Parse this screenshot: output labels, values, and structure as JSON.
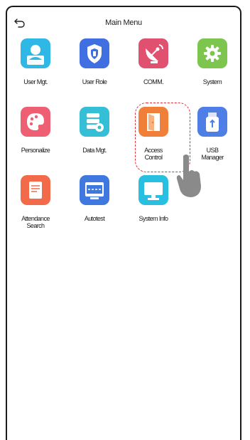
{
  "header": {
    "back_icon": "back-arrow-icon",
    "title": "Main Menu"
  },
  "menu": {
    "items": [
      {
        "label": "User Mgt.",
        "icon": "user-icon",
        "color": "#2fb8e6"
      },
      {
        "label": "User Role",
        "icon": "shield-icon",
        "color": "#3f6fe0"
      },
      {
        "label": "COMM.",
        "icon": "satellite-dish-icon",
        "color": "#e0506f"
      },
      {
        "label": "System",
        "icon": "gear-icon",
        "color": "#7cc650"
      },
      {
        "label": "Personalize",
        "icon": "palette-icon",
        "color": "#ef5f73"
      },
      {
        "label": "Data Mgt.",
        "icon": "database-icon",
        "color": "#35bfd6"
      },
      {
        "label": "Access\nControl",
        "icon": "door-icon",
        "color": "#f07f3a"
      },
      {
        "label": "USB\nManager",
        "icon": "usb-drive-icon",
        "color": "#4f7fe6"
      },
      {
        "label": "Attendance\nSearch",
        "icon": "document-search-icon",
        "color": "#f26a4a"
      },
      {
        "label": "Autotest",
        "icon": "test-monitor-icon",
        "color": "#3f79e0"
      },
      {
        "label": "System Info",
        "icon": "monitor-icon",
        "color": "#29bfe0"
      }
    ]
  },
  "annotation": {
    "highlight_color": "#e0303a",
    "pointer_icon": "hand-pointer-icon"
  }
}
